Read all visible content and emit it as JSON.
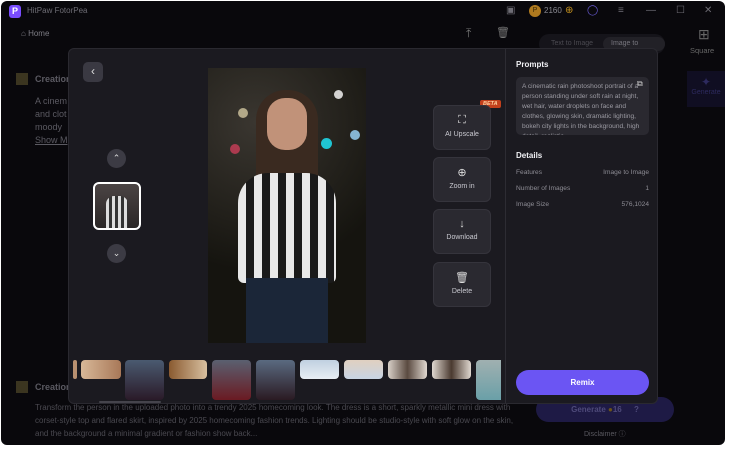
{
  "app": {
    "title": "HitPaw FotorPea",
    "credits": "2160"
  },
  "nav": {
    "home": "Home"
  },
  "mode_tabs": [
    "Text to Image",
    "Image to Image"
  ],
  "sidebar": {
    "square": "Square",
    "generate": "Generate"
  },
  "background": {
    "creation_title": "Creation",
    "creation1_text": [
      "A cinem",
      "and clot",
      "moody"
    ],
    "show_more": "Show M",
    "creation2_text": "Transform the person in the uploaded photo into a trendy 2025 homecoming look. The dress is a short, sparkly metallic mini dress with corset-style top and flared skirt, inspired by 2025 homecoming fashion trends. Lighting should be studio-style with soft glow on the skin, and the background a minimal gradient or fashion show back...",
    "generate": "Generate",
    "generate_cost": "16",
    "disclaimer": "Disclaimer"
  },
  "modal": {
    "actions": [
      {
        "label": "AI Upscale",
        "icon": "expand-icon"
      },
      {
        "label": "Zoom in",
        "icon": "zoom-in-icon"
      },
      {
        "label": "Download",
        "icon": "download-icon"
      },
      {
        "label": "Delete",
        "icon": "trash-icon"
      }
    ],
    "beta": "BETA",
    "prompts_title": "Prompts",
    "prompt": "A cinematic rain photoshoot portrait of a person standing under soft rain at night, wet hair, water droplets on face and clothes, glowing skin, dramatic lighting, bokeh city lights in the background, high detail, realistic",
    "details_title": "Details",
    "details": [
      {
        "k": "Features",
        "v": "Image to Image"
      },
      {
        "k": "Number of Images",
        "v": "1"
      },
      {
        "k": "Image Size",
        "v": "576,1024"
      }
    ],
    "remix": "Remix"
  }
}
